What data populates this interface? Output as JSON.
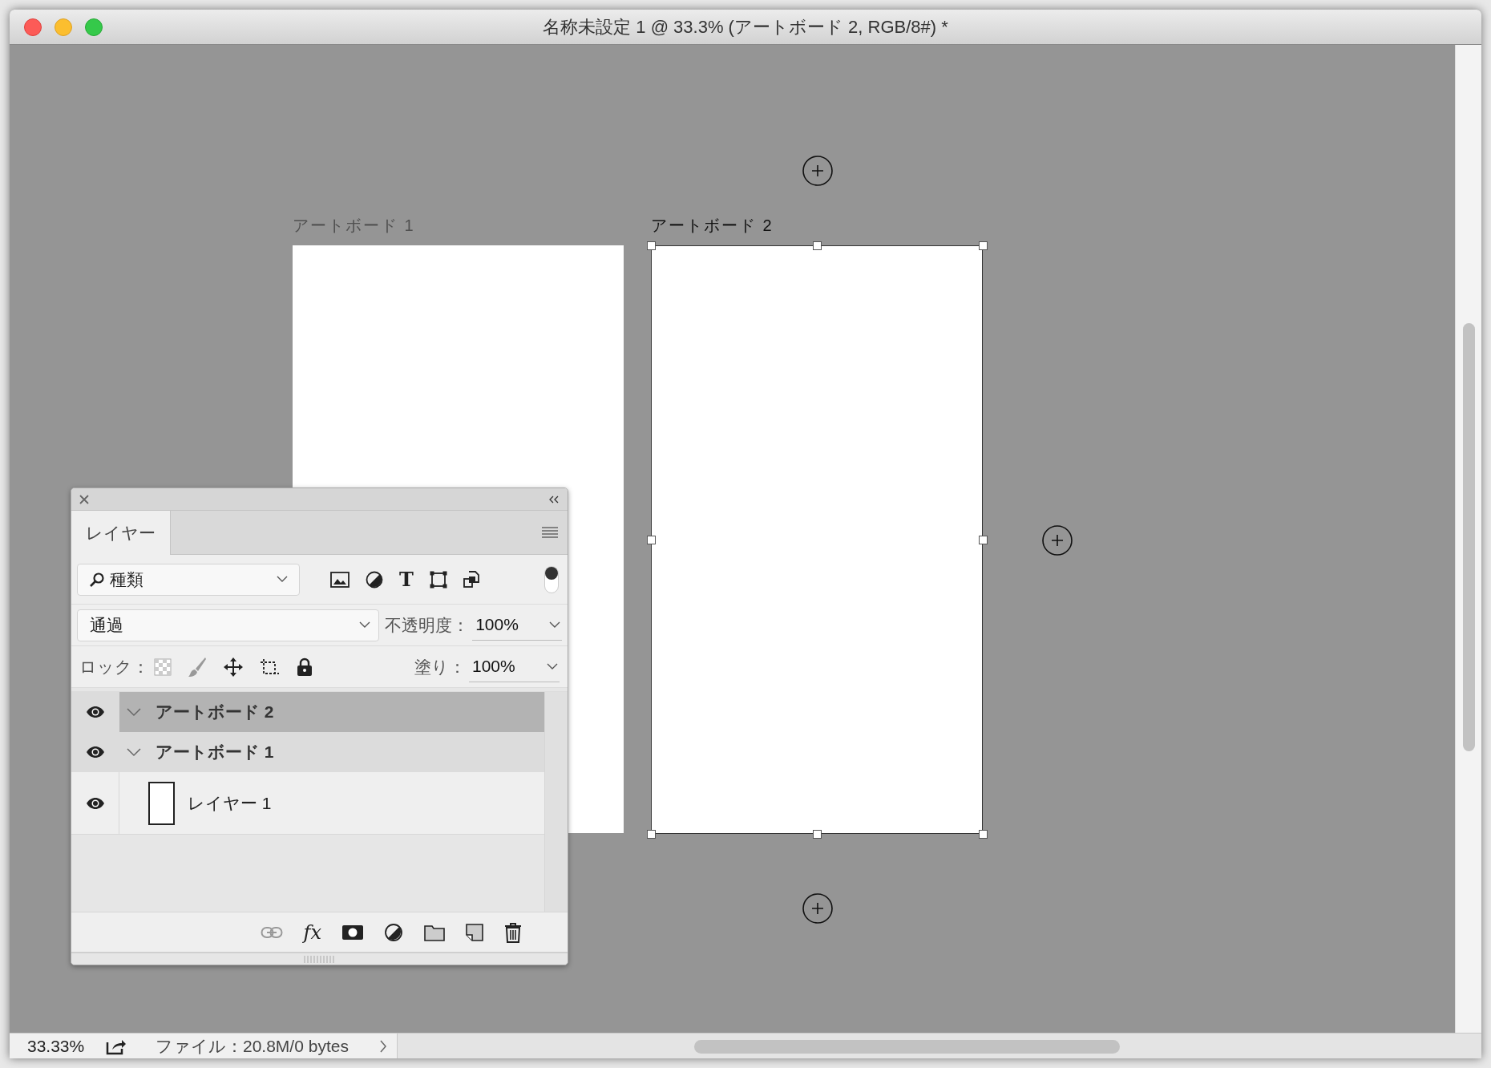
{
  "window": {
    "title": "名称未設定 1 @ 33.3% (アートボード 2, RGB/8#) *"
  },
  "canvas": {
    "artboards": [
      {
        "label": "アートボード 1",
        "selected": false
      },
      {
        "label": "アートボード 2",
        "selected": true
      }
    ]
  },
  "layers_panel": {
    "tab": {
      "label": "レイヤー",
      "selected": true
    },
    "filter": {
      "value": "種類"
    },
    "type_filter": "T",
    "filter_toggle": {
      "on": true
    },
    "blend_mode": {
      "value": "通過"
    },
    "opacity": {
      "label": "不透明度：",
      "value": "100%"
    },
    "lock_label": "ロック：",
    "fill": {
      "label": "塗り：",
      "value": "100%"
    },
    "layers": [
      {
        "name": "アートボード 2",
        "kind": "artboard",
        "selected": true,
        "expanded": true,
        "visible": true
      },
      {
        "name": "アートボード 1",
        "kind": "artboard",
        "selected": false,
        "expanded": true,
        "visible": true,
        "children": [
          {
            "name": "レイヤー 1",
            "kind": "pixel",
            "selected": false,
            "visible": true
          }
        ]
      }
    ],
    "effects_button": "fx"
  },
  "status_bar": {
    "zoom": "33.33%",
    "info": "ファイル：20.8M/0 bytes"
  }
}
